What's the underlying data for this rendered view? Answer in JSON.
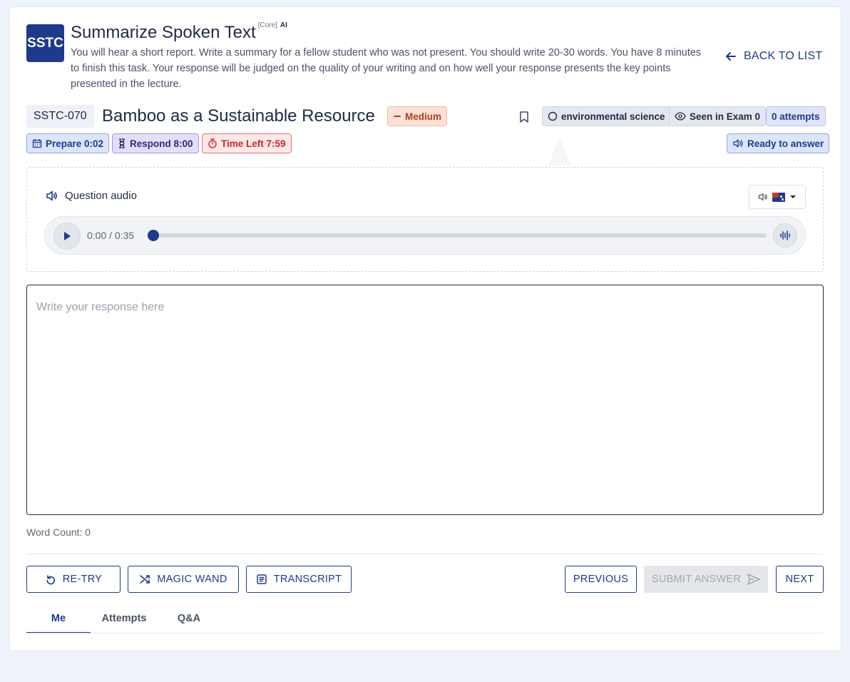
{
  "header": {
    "logo_text": "SSTC",
    "title": "Summarize Spoken Text",
    "tag": "[Core]",
    "ai_label": "AI",
    "description": "You will hear a short report. Write a summary for a fellow student who was not present. You should write 20-30 words. You have 8 minutes to finish this task. Your response will be judged on the quality of your writing and on how well your response presents the key points presented in the lecture.",
    "back_label": "BACK TO LIST"
  },
  "question": {
    "id": "SSTC-070",
    "title": "Bamboo as a Sustainable Resource",
    "difficulty": "Medium",
    "topic": "environmental science",
    "seen_in_exam": "Seen in Exam 0",
    "attempts": "0 attempts"
  },
  "timers": {
    "prepare": "Prepare 0:02",
    "respond": "Respond 8:00",
    "time_left": "Time Left 7:59",
    "status": "Ready to answer"
  },
  "audio": {
    "label": "Question audio",
    "time": "0:00 / 0:35",
    "progress": 0,
    "accent": "Australian"
  },
  "response": {
    "placeholder": "Write your response here",
    "value": "",
    "word_count": "Word Count: 0"
  },
  "actions": {
    "retry": "RE-TRY",
    "magic_wand": "MAGIC WAND",
    "transcript": "TRANSCRIPT",
    "previous": "PREVIOUS",
    "submit": "SUBMIT ANSWER",
    "next": "NEXT"
  },
  "tabs": [
    "Me",
    "Attempts",
    "Q&A"
  ],
  "colors": {
    "primary": "#1e3a8a",
    "medium_badge": "#fde1d7",
    "time_left": "#c62828"
  }
}
